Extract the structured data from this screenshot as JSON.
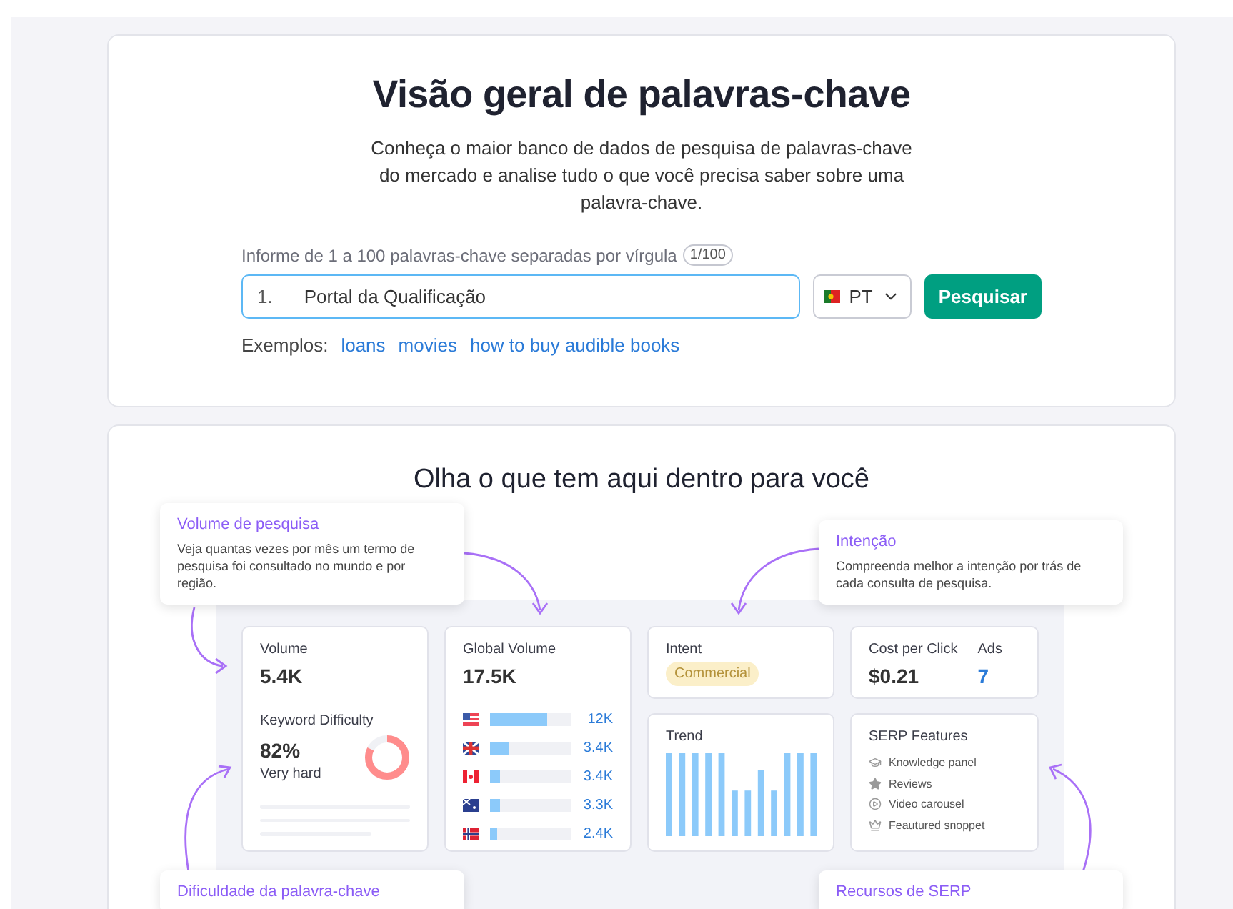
{
  "header": {
    "title": "Visão geral de palavras-chave",
    "subtitle": "Conheça o maior banco de dados de pesquisa de palavras-chave do mercado e analise tudo o que você precisa saber sobre uma palavra-chave."
  },
  "search": {
    "label": "Informe de 1 a 100 palavras-chave separadas por vírgula",
    "counter": "1/100",
    "line_number": "1.",
    "value": "Portal da Qualificação",
    "database": "PT",
    "button": "Pesquisar"
  },
  "examples": {
    "label": "Exemplos:",
    "links": [
      "loans",
      "movies",
      "how to buy audible books"
    ]
  },
  "features": {
    "title": "Olha o que tem aqui dentro para você",
    "callouts": [
      {
        "title": "Volume de pesquisa",
        "text": "Veja quantas vezes por mês um termo de pesquisa foi consultado no mundo e por região."
      },
      {
        "title": "Intenção",
        "text": "Compreenda melhor a intenção por trás de cada consulta de pesquisa."
      },
      {
        "title": "Dificuldade da palavra-chave"
      },
      {
        "title": "Recursos de SERP"
      }
    ],
    "volume": {
      "label": "Volume",
      "value": "5.4K",
      "difficulty_label": "Keyword Difficulty",
      "difficulty_value": "82%",
      "difficulty_text": "Very hard",
      "level": 0.82
    },
    "global_volume": {
      "label": "Global Volume",
      "value": "17.5K",
      "rows": [
        {
          "kind": "us",
          "level": 0.7,
          "value": "12K"
        },
        {
          "kind": "uk",
          "level": 0.22,
          "value": "3.4K"
        },
        {
          "kind": "ca",
          "level": 0.13,
          "value": "3.4K"
        },
        {
          "kind": "au",
          "level": 0.13,
          "value": "3.3K"
        },
        {
          "kind": "no",
          "level": 0.08,
          "value": "2.4K"
        }
      ]
    },
    "intent": {
      "label": "Intent",
      "badge": "Commercial"
    },
    "cpc": {
      "label": "Cost per Click",
      "value": "$0.21",
      "ads_label": "Ads",
      "ads_value": "7"
    },
    "trend": {
      "label": "Trend"
    },
    "serp": {
      "label": "SERP Features",
      "items": [
        {
          "kind": "knowledge",
          "text": "Knowledge panel"
        },
        {
          "kind": "reviews",
          "text": "Reviews"
        },
        {
          "kind": "video",
          "text": "Video carousel"
        },
        {
          "kind": "featured",
          "text": "Feautured snoppet"
        }
      ]
    }
  }
}
